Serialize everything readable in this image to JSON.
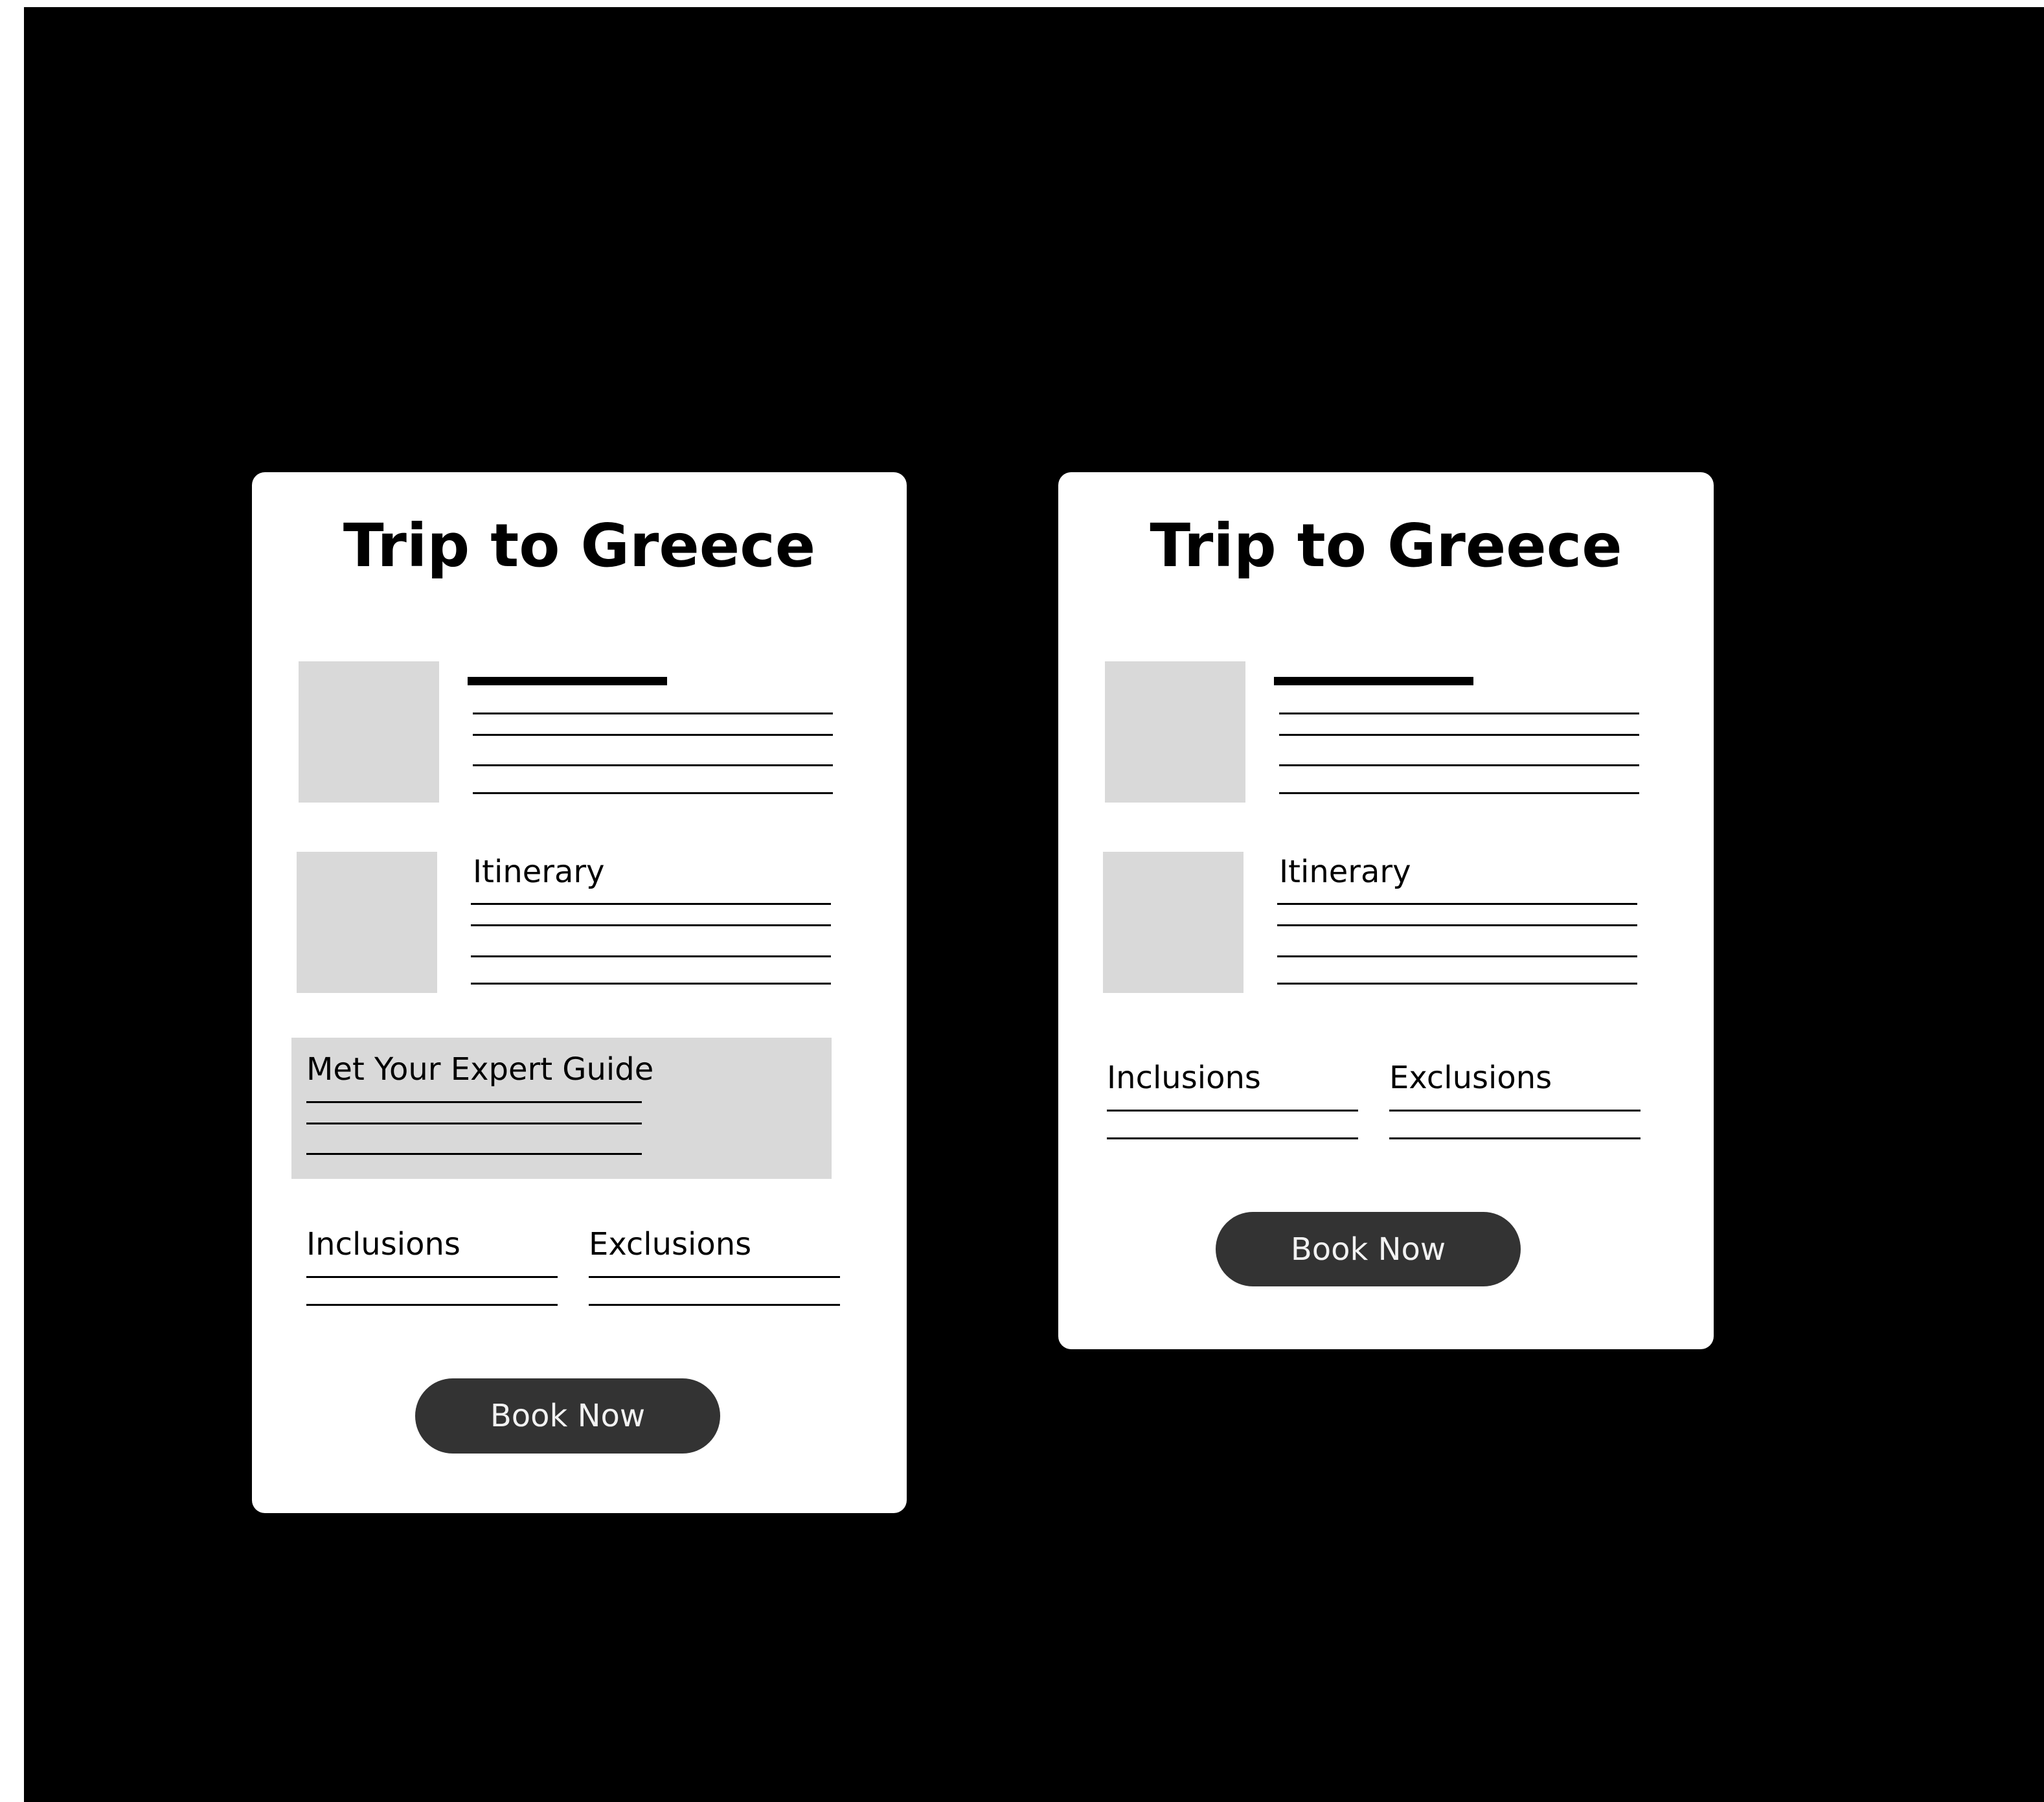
{
  "cards": [
    {
      "title": "Trip to Greece",
      "itinerary_label": "Itinerary",
      "guide_label": "Met Your Expert Guide",
      "inclusions_label": "Inclusions",
      "exclusions_label": "Exclusions",
      "button_label": "Book Now"
    },
    {
      "title": "Trip to Greece",
      "itinerary_label": "Itinerary",
      "inclusions_label": "Inclusions",
      "exclusions_label": "Exclusions",
      "button_label": "Book Now"
    }
  ],
  "colors": {
    "background": "#000000",
    "card": "#ffffff",
    "placeholder": "#d9d9d9",
    "button": "#333333",
    "button_text": "#f2f2f2"
  }
}
